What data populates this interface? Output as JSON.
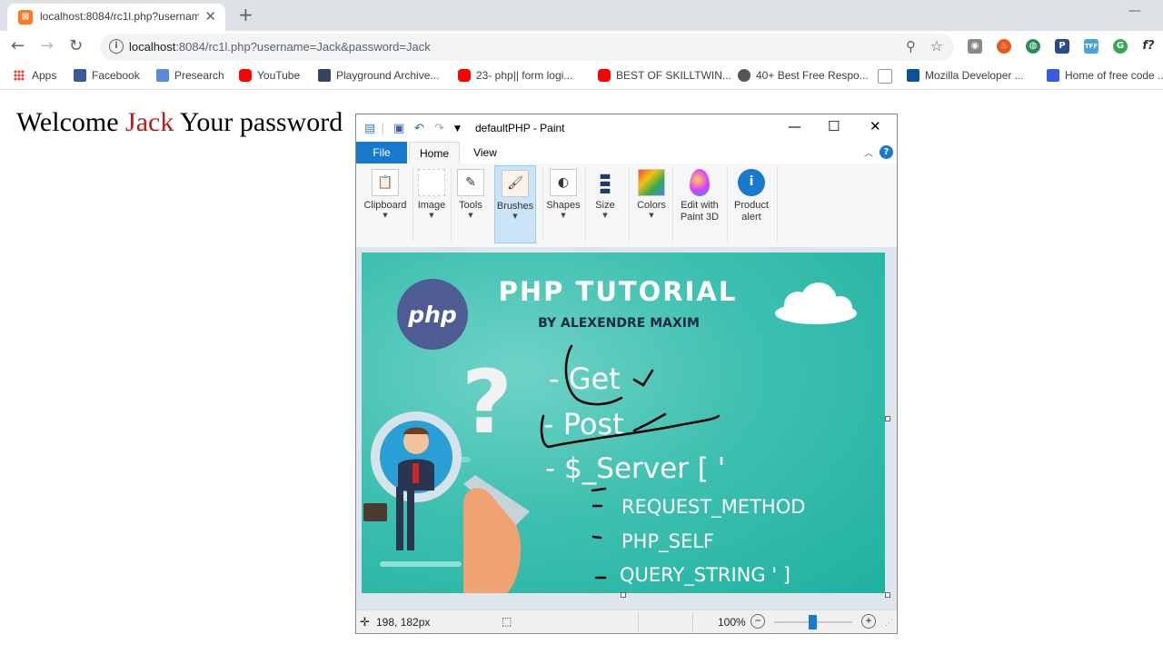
{
  "browser": {
    "tab_title": "localhost:8084/rc1l.php?usernam",
    "url_host": "localhost",
    "url_rest": ":8084/rc1l.php?username=Jack&password=Jack",
    "bookmarks": [
      {
        "label": "Apps"
      },
      {
        "label": "Facebook",
        "color": "#3b5998"
      },
      {
        "label": "Presearch",
        "color": "#5a8bd6"
      },
      {
        "label": "YouTube",
        "color": "#ff0000"
      },
      {
        "label": "Playground Archive...",
        "color": "#35465c"
      },
      {
        "label": "23- php|| form logi...",
        "color": "#ff0000"
      },
      {
        "label": "BEST OF SKILLTWIN...",
        "color": "#ff0000"
      },
      {
        "label": "40+ Best Free Respo...",
        "color": "#555555"
      },
      {
        "label": "",
        "color": "#dddddd"
      },
      {
        "label": "Mozilla Developer ...",
        "color": "#0b5394"
      },
      {
        "label": "Home of free code ...",
        "color": "#3b5bdb"
      }
    ]
  },
  "page": {
    "welcome_prefix": "Welcome",
    "username": "Jack",
    "password_text": "Your password"
  },
  "paint": {
    "title": "defaultPHP - Paint",
    "tabs": {
      "file": "File",
      "home": "Home",
      "view": "View"
    },
    "ribbon": [
      {
        "label": "Clipboard",
        "icon": "clipboard-icon"
      },
      {
        "label": "Image",
        "icon": "select-icon"
      },
      {
        "label": "Tools",
        "icon": "pencil-icon"
      },
      {
        "label": "Brushes",
        "icon": "brush-icon"
      },
      {
        "label": "Shapes",
        "icon": "shapes-icon"
      },
      {
        "label": "Size",
        "icon": "lines-icon"
      },
      {
        "label": "Colors",
        "icon": "palette-icon"
      },
      {
        "label": "Edit with Paint 3D",
        "icon": "paint3d-icon"
      },
      {
        "label": "Product alert",
        "icon": "info-icon"
      }
    ],
    "status": {
      "coords": "198, 182px",
      "zoom": "100%"
    },
    "zoom_level": 0.5
  },
  "canvas_image": {
    "title": "PHP TUTORIAL",
    "byline": "BY ALEXENDRE MAXIM",
    "php_logo": "php",
    "items": [
      "- Get",
      "- Post",
      "- $_Server [ '"
    ],
    "sub_items": [
      "REQUEST_METHOD",
      "PHP_SELF",
      "QUERY_STRING   ' ]"
    ]
  },
  "colors": {
    "accent": "#1979ca",
    "username": "#b81c1c",
    "canvas_teal": "#2bb8a6",
    "php_logo_bg": "#4f5b93"
  }
}
